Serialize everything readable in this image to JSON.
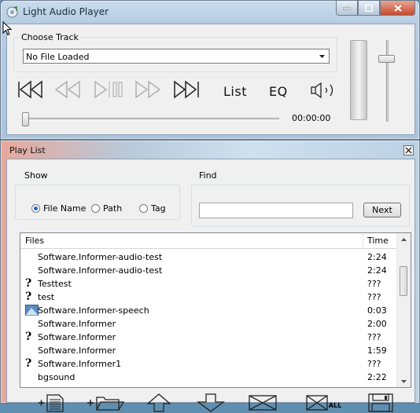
{
  "main_window": {
    "title": "Light Audio Player",
    "choose_track_label": "Choose Track",
    "track_selected": "No File Loaded",
    "list_label": "List",
    "eq_label": "EQ",
    "time_display": "00:00:00",
    "volume_level": 0.82,
    "seek_position": 0.0
  },
  "playlist_window": {
    "title": "Play List",
    "show_label": "Show",
    "show_options": [
      "File Name",
      "Path",
      "Tag"
    ],
    "show_selected": "File Name",
    "find_label": "Find",
    "find_value": "",
    "next_label": "Next",
    "columns": [
      "Files",
      "Time"
    ],
    "rows": [
      {
        "name": "Software.Informer-audio-test",
        "time": "2:24",
        "icon": "none"
      },
      {
        "name": "Software.Informer-audio-test",
        "time": "2:24",
        "icon": "none"
      },
      {
        "name": "Testtest",
        "time": "???",
        "icon": "question-icon"
      },
      {
        "name": "test",
        "time": "???",
        "icon": "question-icon"
      },
      {
        "name": "Software.Informer-speech",
        "time": "0:03",
        "icon": "image-file-icon"
      },
      {
        "name": "Software.Informer",
        "time": "2:00",
        "icon": "none"
      },
      {
        "name": "Software.Informer",
        "time": "???",
        "icon": "question-icon"
      },
      {
        "name": "Software.Informer",
        "time": "1:59",
        "icon": "none"
      },
      {
        "name": "Software.Informer1",
        "time": "???",
        "icon": "question-icon"
      },
      {
        "name": "bgsound",
        "time": "2:22",
        "icon": "none"
      }
    ],
    "bottom_all_label": "ALL"
  },
  "colors": {
    "title_bar": "#b6cde3",
    "close_button": "#c7482e",
    "client_bg": "#f0f0f0",
    "radio_dot": "#1e62c8"
  }
}
